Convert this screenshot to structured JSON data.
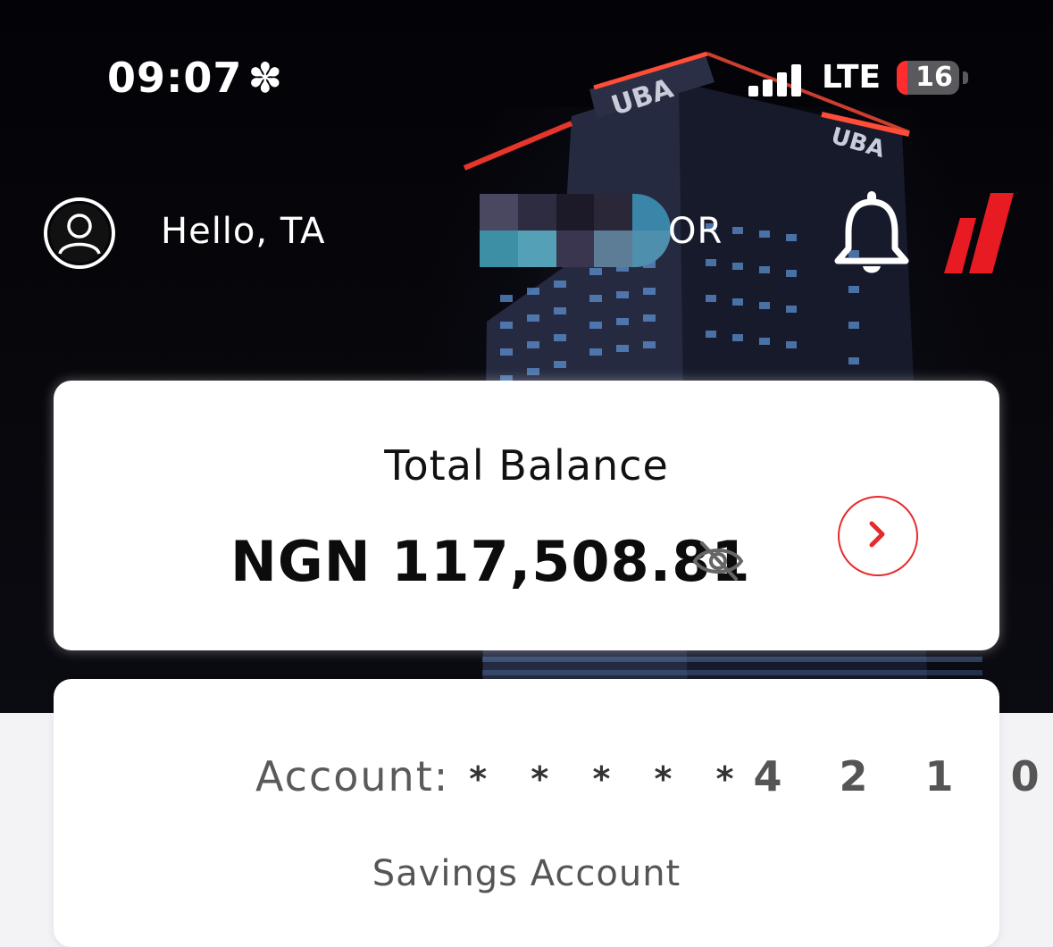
{
  "status_bar": {
    "time": "09:07",
    "time_indicator": "✽",
    "network": "LTE",
    "battery": "16",
    "icons": [
      "signal-bars-icon",
      "battery-icon"
    ]
  },
  "header": {
    "greeting_start": "Hello, TA",
    "greeting_end": "OR",
    "icons": [
      "user-avatar-icon",
      "bell-icon",
      "uba-logo-icon"
    ]
  },
  "balance_card": {
    "label": "Total Balance",
    "amount": "NGN 117,508.81",
    "icons": [
      "eye-off-icon",
      "chevron-right-icon"
    ],
    "accent_color": "#e52b2b"
  },
  "account_card": {
    "label": "Account:",
    "mask": "* * * * *",
    "last_digits": "4 2 1 0",
    "type": "Savings Account"
  },
  "hero_building_signs": [
    "UBA",
    "UBA"
  ]
}
